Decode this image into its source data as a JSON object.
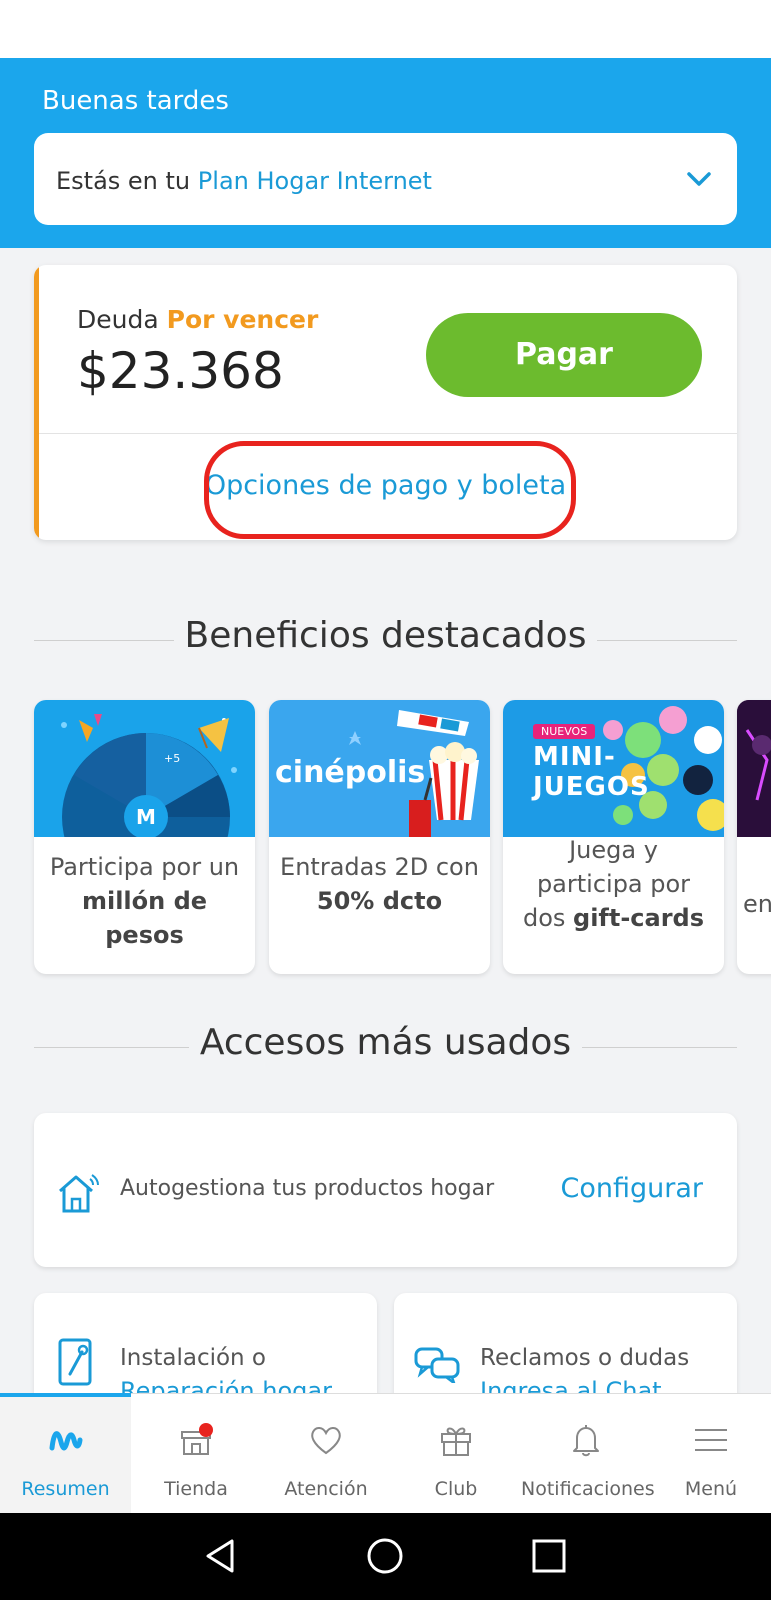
{
  "header": {
    "greeting": "Buenas tardes",
    "plan_prefix": "Estás en tu",
    "plan_name": "Plan Hogar Internet"
  },
  "debt": {
    "label": "Deuda",
    "status": "Por vencer",
    "amount": "$23.368",
    "pay_label": "Pagar",
    "payment_options": "Opciones de pago y boleta"
  },
  "benefits": {
    "title": "Beneficios destacados",
    "cards": [
      {
        "line1": "Participa por un",
        "bold": "millón de pesos"
      },
      {
        "logo": "cinépolis",
        "line1": "Entradas 2D con",
        "bold": "50% dcto"
      },
      {
        "badge": "NUEVOS",
        "game_title_1": "MINI-",
        "game_title_2": "JUEGOS",
        "line1": "Juega y",
        "line2": "participa por",
        "line3_prefix": "dos",
        "bold": "gift-cards"
      },
      {
        "partial_text": "en"
      }
    ]
  },
  "accesses": {
    "title": "Accesos más usados",
    "main": {
      "text": "Autogestiona tus productos hogar",
      "link": "Configurar"
    },
    "left": {
      "title": "Instalación o",
      "link": "Reparación hogar"
    },
    "right": {
      "title": "Reclamos o dudas",
      "link": "Ingresa al Chat"
    }
  },
  "tabs": [
    {
      "label": "Resumen",
      "icon": "movistar-m-icon",
      "active": true
    },
    {
      "label": "Tienda",
      "icon": "store-icon",
      "active": false
    },
    {
      "label": "Atención",
      "icon": "heart-icon",
      "active": false
    },
    {
      "label": "Club",
      "icon": "gift-icon",
      "active": false
    },
    {
      "label": "Notificaciones",
      "icon": "bell-icon",
      "active": false
    },
    {
      "label": "Menú",
      "icon": "hamburger-icon",
      "active": false
    }
  ],
  "colors": {
    "brand_blue": "#1ba6ec",
    "link_blue": "#1a9ad6",
    "pay_green": "#6cbb2e",
    "due_orange": "#f29a1f",
    "highlight_red": "#e8231e"
  }
}
